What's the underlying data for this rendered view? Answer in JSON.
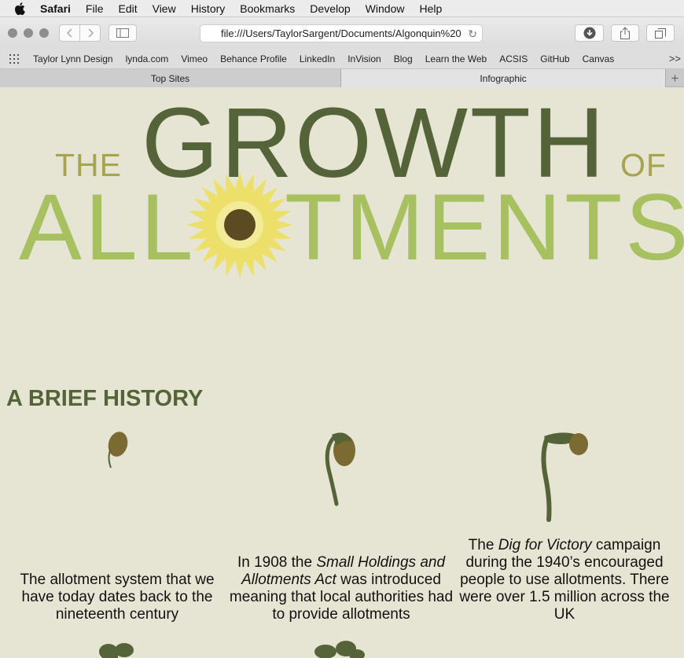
{
  "menubar": {
    "app": "Safari",
    "items": [
      "File",
      "Edit",
      "View",
      "History",
      "Bookmarks",
      "Develop",
      "Window",
      "Help"
    ]
  },
  "toolbar": {
    "url": "file:///Users/TaylorSargent/Documents/Algonquin%20"
  },
  "favorites": {
    "items": [
      "Taylor Lynn Design",
      "lynda.com",
      "Vimeo",
      "Behance Profile",
      "LinkedIn",
      "InVision",
      "Blog",
      "Learn the Web",
      "ACSIS",
      "GitHub",
      "Canvas"
    ],
    "more": ">>"
  },
  "tabs": [
    "Top Sites",
    "Infographic"
  ],
  "page": {
    "title": {
      "the": "THE",
      "growth": "GROWTH",
      "of": "OF",
      "allot_left": "ALL",
      "allot_right": "TMENTS"
    },
    "section_heading": "A BRIEF HISTORY",
    "captions": [
      {
        "text_before": "The allotment system that we have today dates back to the nineteenth century",
        "italic": "",
        "text_after": ""
      },
      {
        "text_before": "In 1908 the ",
        "italic": "Small Holdings and Allotments Act",
        "text_after": " was introduced meaning that local authorities had to provide allotments"
      },
      {
        "text_before": "The ",
        "italic": "Dig for Victory",
        "text_after": " campaign during the 1940’s encouraged people to use allotments. There were over 1.5 million across the UK"
      }
    ],
    "colors": {
      "background": "#e6e5d4",
      "growth_green": "#556338",
      "light_green": "#a8c160",
      "olive": "#a8a34f",
      "sunflower_yellow": "#ede06a",
      "seed_brown": "#7b6a32"
    }
  }
}
